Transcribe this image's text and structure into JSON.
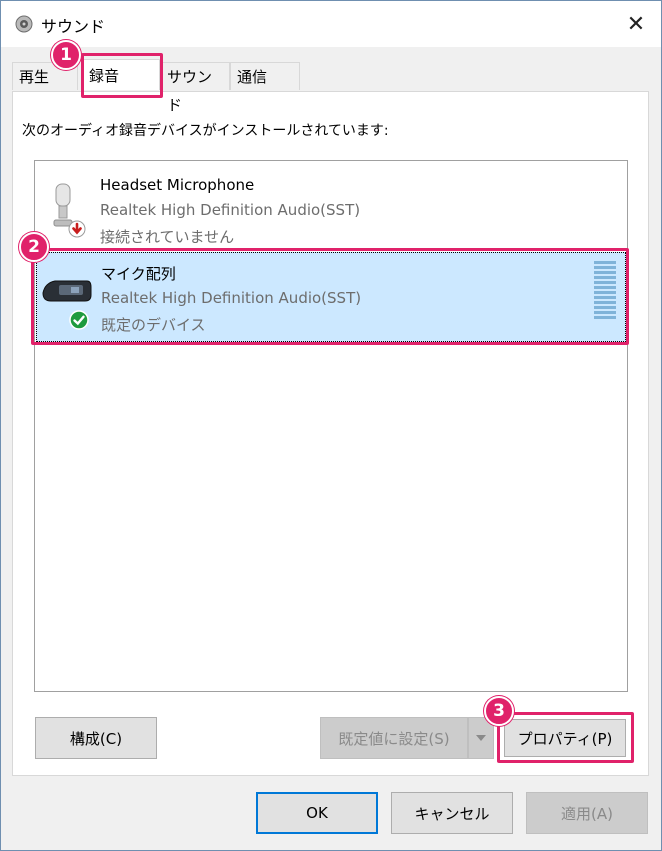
{
  "window": {
    "title": "サウンド",
    "close_glyph": "✕"
  },
  "tabs": [
    {
      "label": "再生"
    },
    {
      "label": "録音"
    },
    {
      "label": "サウンド"
    },
    {
      "label": "通信"
    }
  ],
  "active_tab": "録音",
  "caption": "次のオーディオ録音デバイスがインストールされています:",
  "devices": [
    {
      "name": "Headset Microphone",
      "driver": "Realtek High Definition Audio(SST)",
      "status": "接続されていません",
      "icon": "headset-microphone-icon",
      "status_icon": "disconnected-down-arrow-icon"
    },
    {
      "name": "マイク配列",
      "driver": "Realtek High Definition Audio(SST)",
      "status": "既定のデバイス",
      "icon": "microphone-array-icon",
      "status_icon": "default-checkmark-icon",
      "selected": true,
      "level": 0
    }
  ],
  "buttons": {
    "configure": "構成(C)",
    "set_default": "既定値に設定(S)",
    "properties": "プロパティ(P)",
    "ok": "OK",
    "cancel": "キャンセル",
    "apply": "適用(A)"
  },
  "annotations": {
    "step1": "1",
    "step2": "2",
    "step3": "3",
    "color": "#e0226a"
  }
}
